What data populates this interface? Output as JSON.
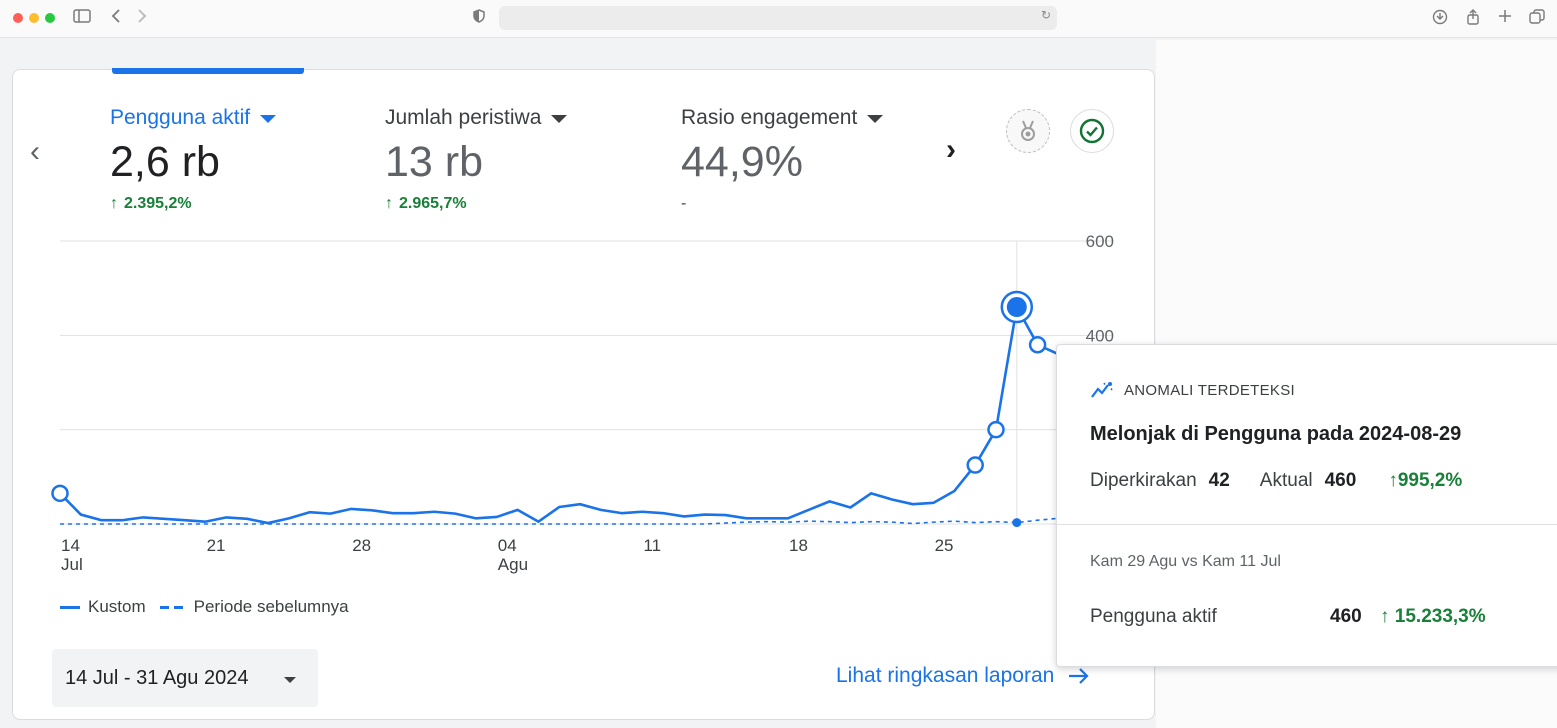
{
  "metrics": [
    {
      "label": "Pengguna aktif",
      "value": "2,6 rb",
      "change": "2.395,2%",
      "arrow": "↑"
    },
    {
      "label": "Jumlah peristiwa",
      "value": "13 rb",
      "change": "2.965,7%",
      "arrow": "↑"
    },
    {
      "label": "Rasio engagement",
      "value": "44,9%",
      "change": "-"
    }
  ],
  "chart_data": {
    "type": "line",
    "ylim": [
      0,
      600
    ],
    "y_ticks": [
      "600",
      "400",
      "0"
    ],
    "x_ticks": [
      {
        "day": "14",
        "month": "Jul"
      },
      {
        "day": "21",
        "month": ""
      },
      {
        "day": "28",
        "month": ""
      },
      {
        "day": "04",
        "month": "Agu"
      },
      {
        "day": "11",
        "month": ""
      },
      {
        "day": "18",
        "month": ""
      },
      {
        "day": "25",
        "month": ""
      }
    ],
    "series": [
      {
        "name": "Kustom",
        "style": "solid",
        "x_start": "2024-07-14",
        "values": [
          65,
          20,
          8,
          8,
          14,
          11,
          8,
          5,
          14,
          11,
          2,
          12,
          25,
          22,
          32,
          29,
          23,
          23,
          26,
          22,
          12,
          15,
          30,
          5,
          36,
          42,
          30,
          23,
          26,
          23,
          16,
          20,
          19,
          12,
          12,
          12,
          30,
          48,
          35,
          65,
          52,
          42,
          45,
          70,
          125,
          200,
          460,
          380,
          360
        ]
      },
      {
        "name": "Periode sebelumnya",
        "style": "dashed",
        "x_start": "2024-07-14",
        "values": [
          0,
          0,
          0,
          0,
          0,
          0,
          0,
          0,
          0,
          0,
          0,
          0,
          0,
          0,
          0,
          0,
          0,
          0,
          0,
          0,
          0,
          0,
          0,
          0,
          0,
          0,
          0,
          0,
          0,
          0,
          0,
          0,
          2,
          4,
          5,
          4,
          6,
          5,
          3,
          5,
          4,
          1,
          4,
          6,
          3,
          5,
          3,
          8,
          12
        ]
      }
    ]
  },
  "legend": {
    "current": "Kustom",
    "previous": "Periode sebelumnya"
  },
  "date_range": "14 Jul - 31 Agu 2024",
  "report_link": "Lihat ringkasan laporan",
  "anomaly": {
    "header": "ANOMALI TERDETEKSI",
    "title": "Melonjak di Pengguna pada 2024-08-29",
    "expected_label": "Diperkirakan",
    "expected_value": "42",
    "actual_label": "Aktual",
    "actual_value": "460",
    "change": "↑995,2%",
    "comparison": "Kam 29 Agu vs Kam 11 Jul",
    "metric_label": "Pengguna aktif",
    "metric_value": "460",
    "metric_change": "↑ 15.233,3%"
  },
  "colors": {
    "accent": "#1a73e8",
    "positive": "#188038",
    "text": "#202124"
  },
  "icons": [
    "sidebar-icon",
    "back-icon",
    "forward-icon",
    "shield-icon",
    "reload-icon",
    "download-icon",
    "share-icon",
    "new-tab-icon",
    "tabs-icon",
    "medal-icon",
    "check-circle-icon",
    "anomaly-icon",
    "arrow-right-icon"
  ]
}
